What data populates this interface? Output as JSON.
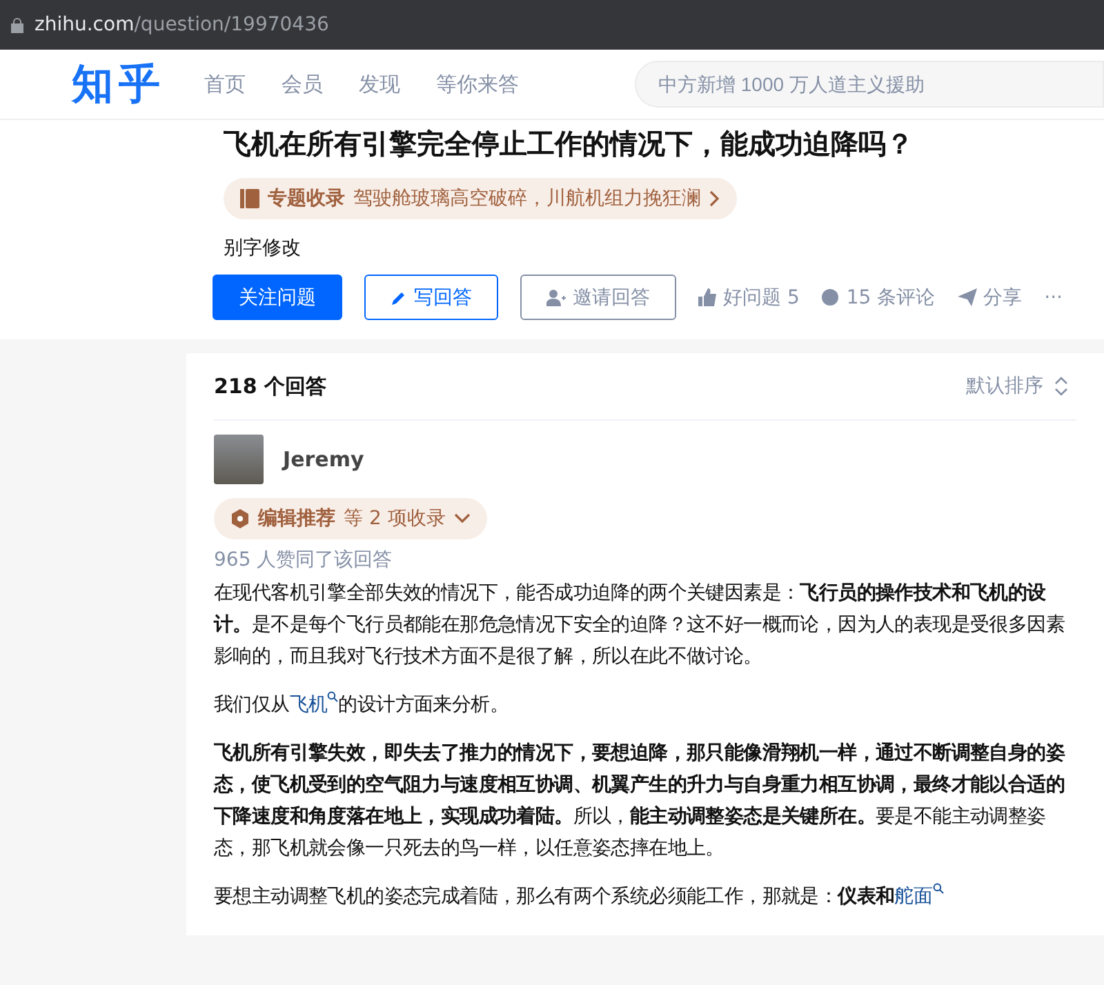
{
  "address_bar": {
    "domain": "zhihu.com",
    "path": "/question/19970436"
  },
  "header": {
    "logo": "知乎",
    "nav": [
      {
        "label": "首页",
        "selected": false
      },
      {
        "label": "会员",
        "selected": false
      },
      {
        "label": "发现",
        "selected": false
      },
      {
        "label": "等你来答",
        "selected": false
      }
    ],
    "search": {
      "placeholder": "中方新增 1000 万人道主义援助"
    }
  },
  "question": {
    "title": "飞机在所有引擎完全停止工作的情况下，能成功迫降吗？",
    "topic_tag": {
      "label": "专题收录",
      "text": "驾驶舱玻璃高空破碎，川航机组力挽狂澜"
    },
    "edit_note": "别字修改",
    "actions": [
      {
        "kind": "primary",
        "label": "关注问题"
      },
      {
        "kind": "write",
        "label": "写回答"
      },
      {
        "kind": "invite",
        "label": "邀请回答"
      },
      {
        "kind": "like",
        "label": "好问题 5"
      },
      {
        "kind": "comment",
        "label": "15 条评论"
      },
      {
        "kind": "share",
        "label": "分享"
      },
      {
        "kind": "more",
        "label": "···"
      }
    ]
  },
  "answers": {
    "count": "218 个回答",
    "sort": "默认排序",
    "answer": {
      "author": "Jeremy",
      "badge": {
        "label": "编辑推荐",
        "text": "等 2 项收录"
      },
      "votes": "965 人赞同了该回答",
      "paragraphs": [
        [
          {
            "kind": "text",
            "text": "在现代客机引擎全部失效的情况下，能否成功迫降的两个关键因素是："
          },
          {
            "kind": "bold",
            "text": "飞行员的操作技术和飞机的设计。"
          },
          {
            "kind": "text",
            "text": "是不是每个飞行员都能在那危急情况下安全的迫降？这不好一概而论，因为人的表现是受很多因素影响的，而且我对飞行技术方面不是很了解，所以在此不做讨论。"
          }
        ],
        [
          {
            "kind": "text",
            "text": "我们仅从"
          },
          {
            "kind": "link",
            "text": "飞机"
          },
          {
            "kind": "text",
            "text": "的设计方面来分析。"
          }
        ],
        [
          {
            "kind": "bold",
            "text": "飞机所有引擎失效，即失去了推力的情况下，要想迫降，那只能像滑翔机一样，通过不断调整自身的姿态，使飞机受到的空气阻力与速度相互协调、机翼产生的升力与自身重力相互协调，最终才能以合适的下降速度和角度落在地上，实现成功着陆。"
          },
          {
            "kind": "text",
            "text": "所以，"
          },
          {
            "kind": "bold",
            "text": "能主动调整姿态是关键所在。"
          },
          {
            "kind": "text",
            "text": "要是不能主动调整姿态，那飞机就会像一只死去的鸟一样，以任意姿态摔在地上。"
          }
        ],
        [
          {
            "kind": "text",
            "text": "要想主动调整飞机的姿态完成着陆，那么有两个系统必须能工作，那就是："
          },
          {
            "kind": "bold",
            "text": "仪表和"
          },
          {
            "kind": "link",
            "text": "舵面"
          }
        ]
      ]
    }
  }
}
